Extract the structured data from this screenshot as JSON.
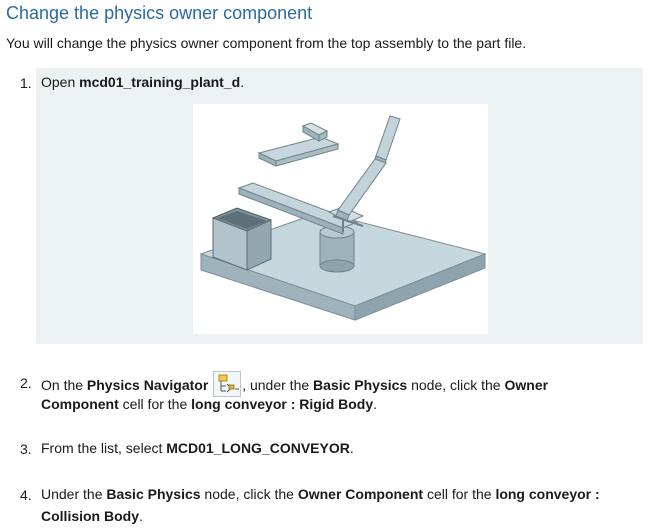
{
  "heading": "Change the physics owner component",
  "intro": "You will change the physics owner component from the top assembly to the part file.",
  "steps": [
    {
      "num": "1.",
      "pre": "Open ",
      "bold": "mcd01_training_plant_d",
      "post": "."
    },
    {
      "num": "2.",
      "line1_a": "On the ",
      "line1_b": "Physics Navigator",
      "line1_c": ", under the ",
      "line1_d": "Basic Physics",
      "line1_e": " node, click the ",
      "line1_f": "Owner",
      "line2_a": "Component",
      "line2_b": " cell for the ",
      "line2_c": "long conveyor : Rigid Body",
      "line2_d": "."
    },
    {
      "num": "3.",
      "pre": "From the list, select ",
      "bold": "MCD01_LONG_CONVEYOR",
      "post": "."
    },
    {
      "num": "4.",
      "line1_a": "Under the ",
      "line1_b": "Basic Physics",
      "line1_c": " node, click the ",
      "line1_d": "Owner Component",
      "line1_e": " cell for the ",
      "line1_f": "long conveyor :",
      "line2_a": "Collision Body",
      "line2_b": "."
    }
  ],
  "icons": {
    "navigator": "physics-navigator-icon"
  }
}
